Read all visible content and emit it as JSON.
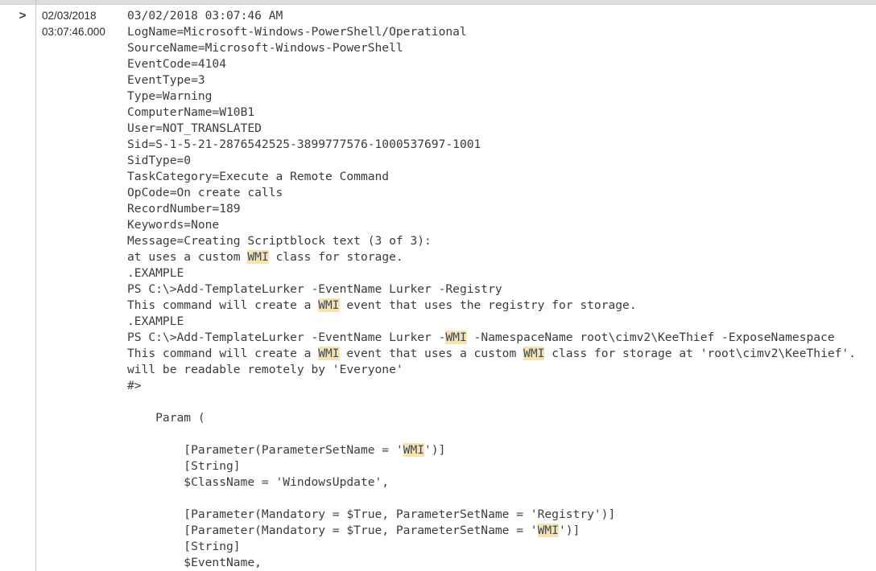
{
  "window": {
    "background_color": "#ffffff",
    "top_band_color": "#dcdcdc",
    "divider_color": "#c8c8c8"
  },
  "highlight": {
    "term": "WMI",
    "background_color": "#f8e2b0",
    "text_color": "#3b4a63"
  },
  "row": {
    "expander_icon": ">",
    "time": {
      "date": "02/03/2018",
      "time": "03:07:46.000"
    },
    "event_lines": [
      {
        "text": "03/02/2018 03:07:46 AM"
      },
      {
        "text": "LogName=Microsoft-Windows-PowerShell/Operational"
      },
      {
        "text": "SourceName=Microsoft-Windows-PowerShell"
      },
      {
        "text": "EventCode=4104"
      },
      {
        "text": "EventType=3"
      },
      {
        "text": "Type=Warning"
      },
      {
        "text": "ComputerName=W10B1"
      },
      {
        "text": "User=NOT_TRANSLATED"
      },
      {
        "text": "Sid=S-1-5-21-2876542525-3899777576-1000537697-1001"
      },
      {
        "text": "SidType=0"
      },
      {
        "text": "TaskCategory=Execute a Remote Command"
      },
      {
        "text": "OpCode=On create calls"
      },
      {
        "text": "RecordNumber=189"
      },
      {
        "text": "Keywords=None"
      },
      {
        "text": "Message=Creating Scriptblock text (3 of 3):"
      },
      {
        "text": "at uses a custom WMI class for storage."
      },
      {
        "text": ".EXAMPLE"
      },
      {
        "text": "PS C:\\>Add-TemplateLurker -EventName Lurker -Registry"
      },
      {
        "text": "This command will create a WMI event that uses the registry for storage."
      },
      {
        "text": ".EXAMPLE"
      },
      {
        "text": "PS C:\\>Add-TemplateLurker -EventName Lurker -WMI -NamespaceName root\\cimv2\\KeeThief -ExposeNamespace"
      },
      {
        "text": "This command will create a WMI event that uses a custom WMI class for storage at 'root\\cimv2\\KeeThief'."
      },
      {
        "text": "will be readable remotely by 'Everyone'"
      },
      {
        "text": "#>"
      },
      {
        "text": ""
      },
      {
        "text": "    Param ("
      },
      {
        "text": ""
      },
      {
        "text": "        [Parameter(ParameterSetName = 'WMI')]"
      },
      {
        "text": "        [String]"
      },
      {
        "text": "        $ClassName = 'WindowsUpdate',"
      },
      {
        "text": ""
      },
      {
        "text": "        [Parameter(Mandatory = $True, ParameterSetName = 'Registry')]"
      },
      {
        "text": "        [Parameter(Mandatory = $True, ParameterSetName = 'WMI')]"
      },
      {
        "text": "        [String]"
      },
      {
        "text": "        $EventName,"
      }
    ]
  }
}
